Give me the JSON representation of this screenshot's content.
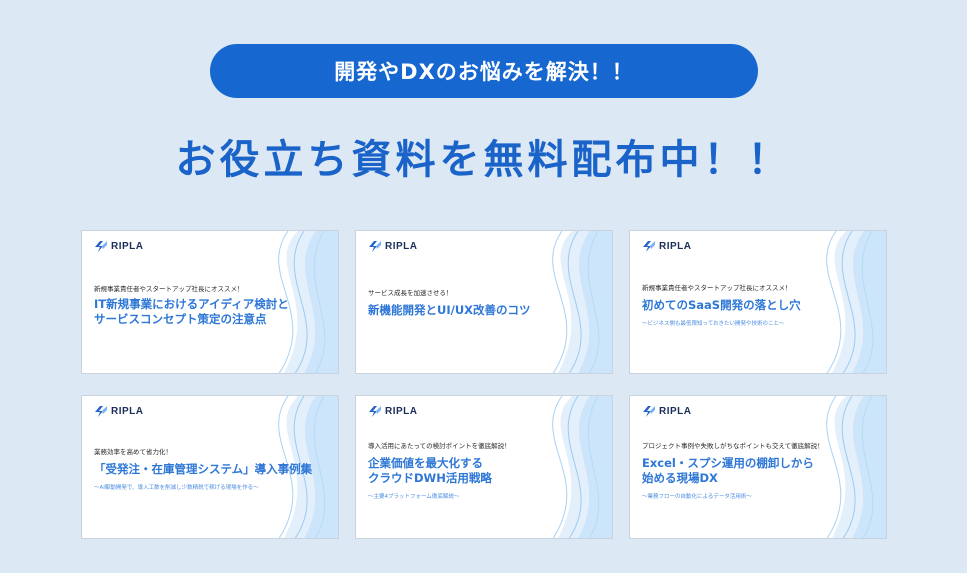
{
  "banner": {
    "text": "開発やDXのお悩みを解決！！"
  },
  "headline": {
    "text": "お役立ち資料を無料配布中！！"
  },
  "logo_text": "RIPLA",
  "colors": {
    "accent": "#1667cf",
    "headline": "#1a63c9",
    "card_title": "#2e77d6",
    "background": "#dde8f5"
  },
  "cards": [
    {
      "lead": "新規事業責任者やスタートアップ社長にオススメ！",
      "title_lines": [
        "IT新規事業におけるアイディア検討と",
        "サービスコンセプト策定の注意点"
      ],
      "sub": ""
    },
    {
      "lead": "サービス成長を加速させる！",
      "title_lines": [
        "新機能開発とUI/UX改善のコツ"
      ],
      "sub": ""
    },
    {
      "lead": "新規事業責任者やスタートアップ社長にオススメ！",
      "title_lines": [
        "初めてのSaaS開発の落とし穴"
      ],
      "sub": "〜ビジネス側も最低限知っておきたい開発や技術のこと〜"
    },
    {
      "lead": "業務効率を高めて省力化！",
      "title_lines": [
        "「受発注・在庫管理システム」導入事例集"
      ],
      "sub": "〜AI駆動開発で、導入工数を削減し少数精鋭で稼げる現場を作る〜"
    },
    {
      "lead": "導入活用にあたっての検討ポイントを徹底解説！",
      "title_lines": [
        "企業価値を最大化する",
        "クラウドDWH活用戦略"
      ],
      "sub": "〜主要4プラットフォーム徹底解説〜"
    },
    {
      "lead": "プロジェクト事例や失敗しがちなポイントも交えて徹底解説！",
      "title_lines": [
        "Excel・スプシ運用の棚卸しから",
        "始める現場DX"
      ],
      "sub": "〜業務フローの自動化によるデータ活用術〜"
    }
  ]
}
